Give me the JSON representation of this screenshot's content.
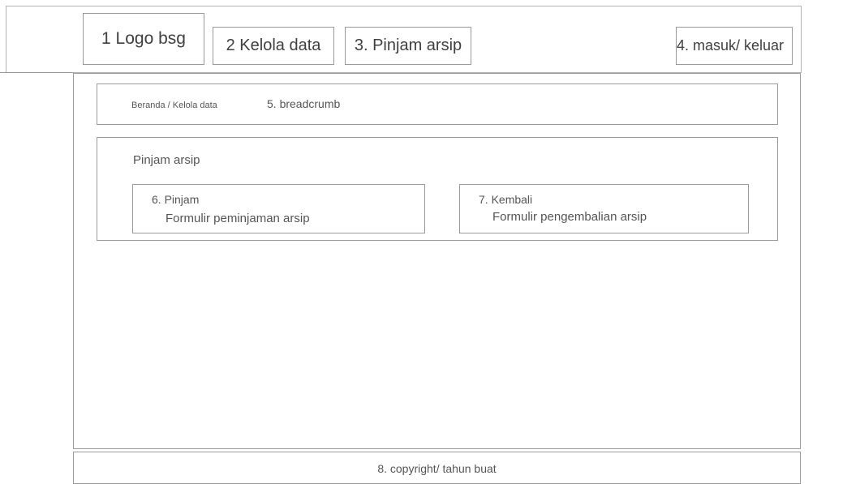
{
  "header": {
    "logo_label": "1 Logo bsg",
    "nav_kelola_label": "2 Kelola data",
    "nav_pinjam_label": "3. Pinjam arsip",
    "auth_label": "4. masuk/ keluar"
  },
  "breadcrumb": {
    "trail": "Beranda / Kelola data",
    "label": "5. breadcrumb"
  },
  "panel": {
    "title": "Pinjam arsip",
    "cards": [
      {
        "title": "6. Pinjam",
        "description": "Formulir peminjaman arsip"
      },
      {
        "title": "7. Kembali",
        "description": "Formulir pengembalian arsip"
      }
    ]
  },
  "footer": {
    "text": "8. copyright/ tahun buat"
  }
}
